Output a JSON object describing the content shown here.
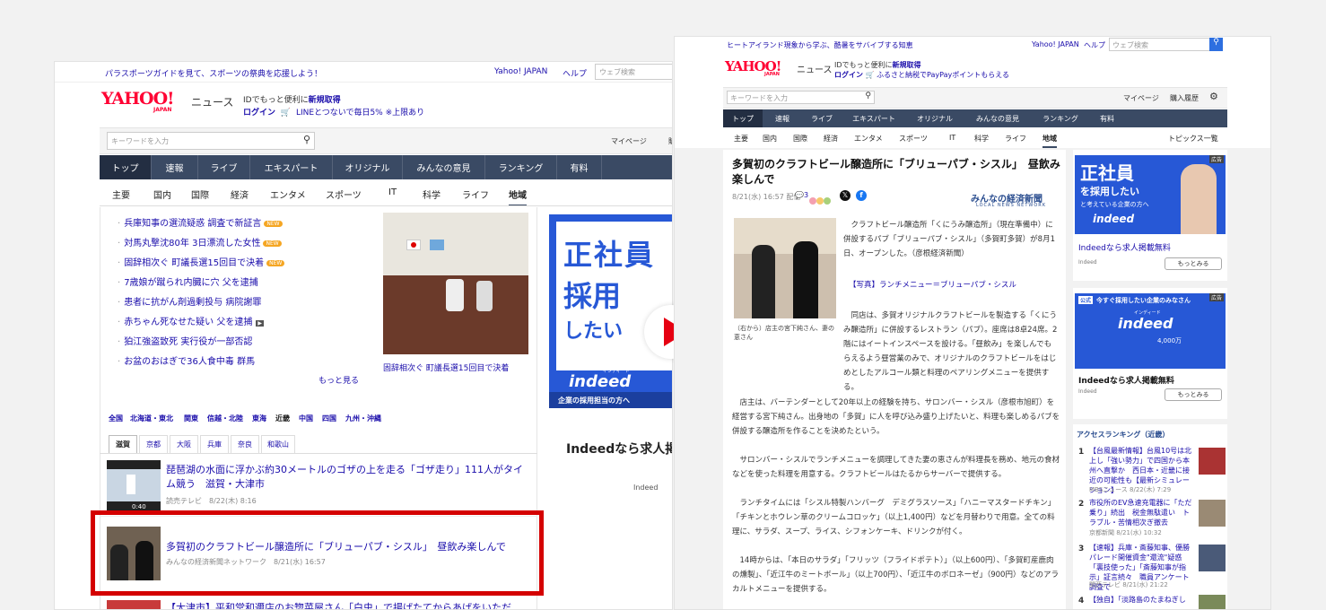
{
  "left": {
    "promo": "パラスポーツガイドを見て、スポーツの祭典を応援しよう！",
    "top_links": [
      "Yahoo! JAPAN",
      "ヘルプ"
    ],
    "search_placeholder": "ウェブ検索",
    "logo": "YAHOO!",
    "logo_sub": "JAPAN",
    "logo_section": "ニュース",
    "id_text": "IDでもっと便利に",
    "id_link": "新規取得",
    "login": "ログイン",
    "line_promo": "LINEとつないで毎日5% ※上限あり",
    "keyword_placeholder": "キーワードを入力",
    "mypage": "マイページ",
    "mypage_cut": "購",
    "nav": [
      "トップ",
      "速報",
      "ライブ",
      "エキスパート",
      "オリジナル",
      "みんなの意見",
      "ランキング",
      "有料"
    ],
    "subnav": [
      "主要",
      "国内",
      "国際",
      "経済",
      "エンタメ",
      "スポーツ",
      "IT",
      "科学",
      "ライフ",
      "地域"
    ],
    "topics": [
      {
        "text": "兵庫知事の選流疑惑 調査で新証言",
        "new": true
      },
      {
        "text": "対馬丸撃沈80年 3日漂流した女性",
        "new": true
      },
      {
        "text": "固辞相次ぐ 町議長選15回目で決着",
        "new": true
      },
      {
        "text": "7歳娘が蹴られ内臓に穴 父を逮捕",
        "new": false
      },
      {
        "text": "患者に抗がん剤過剰投与 病院謝罪",
        "new": false
      },
      {
        "text": "赤ちゃん死なせた疑い 父を逮捕",
        "new": false,
        "video": true
      },
      {
        "text": "狛江強盗致死 実行役が一部否認",
        "new": false
      },
      {
        "text": "お盆のおはぎで36人食中毒 群馬",
        "new": false
      }
    ],
    "new_label": "NEW",
    "more": "もっと見る",
    "photo_caption": "固辞相次ぐ 町議長選15回目で決着",
    "ad": {
      "line1": "正社員",
      "line2": "採用",
      "line3": "したい",
      "brand": "indeed",
      "brand_kana": "インディード",
      "cta": "企業の採用担当の方へ"
    },
    "ad_text": "Indeedなら求人掲",
    "ad_source": "Indeed",
    "regions": [
      "全国",
      "北海道・東北",
      "関東",
      "信越・北陸",
      "東海",
      "近畿",
      "中国",
      "四国",
      "九州・沖縄"
    ],
    "prefs": [
      "滋賀",
      "京都",
      "大阪",
      "兵庫",
      "奈良",
      "和歌山"
    ],
    "articles": [
      {
        "title": "琵琶湖の水面に浮かぶ約30メートルのゴザの上を走る「ゴザ走り」111人がタイム競う　滋賀・大津市",
        "meta": "読売テレビ　8/22(木) 8:16",
        "video_time": "0:40"
      },
      {
        "title": "多賀初のクラフトビール醸造所に「ブリューパブ・シスル」　昼飲み楽しんで",
        "meta": "みんなの経済新聞ネットワーク　8/21(水) 16:57"
      },
      {
        "title": "【大津市】平和堂和邇店のお惣菜屋さん「白虫」で揚げたてからあげをいただ",
        "meta": ""
      }
    ],
    "highlight_color": "#d40000"
  },
  "right": {
    "promo": "ヒートアイランド現象から学ぶ、酷暑をサバイブする知恵",
    "top_links": [
      "Yahoo! JAPAN",
      "ヘルプ"
    ],
    "search_placeholder": "ウェブ検索",
    "logo": "YAHOO!",
    "logo_sub": "JAPAN",
    "logo_section": "ニュース",
    "id_text": "IDでもっと便利に",
    "id_link": "新規取得",
    "login": "ログイン",
    "furusato": "ふるさと納税でPayPayポイントもらえる",
    "keyword_placeholder": "キーワードを入力",
    "header_links": [
      "マイページ",
      "購入履歴"
    ],
    "nav": [
      "トップ",
      "速報",
      "ライブ",
      "エキスパート",
      "オリジナル",
      "みんなの意見",
      "ランキング",
      "有料"
    ],
    "subnav": [
      "主要",
      "国内",
      "国際",
      "経済",
      "エンタメ",
      "スポーツ",
      "IT",
      "科学",
      "ライフ",
      "地域"
    ],
    "topics_list": "トピックス一覧",
    "article_title": "多賀初のクラフトビール醸造所に「ブリューパブ・シスル」　昼飲み楽しんで",
    "article_date": "8/21(水) 16:57 配信",
    "comment_count": "3",
    "source_logo": "みんなの経済新聞",
    "source_logo_sub": "LOCAL NEWS NETWORK",
    "photo_caption": "（右から）店主の宮下純さん、妻の恵さん",
    "lead": "クラフトビール醸造所「くにうみ醸造所」（現在準備中）に併設するパブ「ブリューパブ・シスル」（多賀町多賀）が8月1日、オープンした。（彦根経済新聞）",
    "photo_link": "【写真】ランチメニュー＝ブリューパブ・シスル",
    "p1": "同店は、多賀オリジナルクラフトビールを製造する「くにうみ醸造所」に併設するレストラン（パブ）。座席は8卓24席。2階にはイートインスペースを設ける。「昼飲み」を楽しんでもらえるよう昼営業のみで、オリジナルのクラフトビールをはじめとしたアルコール類と料理のペアリングメニューを提供する。",
    "p2": "店主は、バーテンダーとして20年以上の経験を持ち、サロンバー・シスル（彦根市旭町）を経営する宮下純さん。出身地の「多賀」に人を呼び込み盛り上げたいと、料理も楽しめるパブを併設する醸造所を作ることを決めたという。",
    "p3": "サロンバー・シスルでランチメニューを調理してきた妻の恵さんが料理長を務め、地元の食材などを使った料理を用意する。クラフトビールはたるからサーバーで提供する。",
    "p4": "ランチタイムには「シスル特製ハンバーグ　デミグラスソース」「ハニーマスタードチキン」「チキンとホウレン草のクリームコロッケ」（以上1,400円）などを月替わりで用意。全ての料理に、サラダ、スープ、ライス、シフォンケーキ、ドリンクが付く。",
    "p5": "14時からは、「本日のサラダ」「フリッツ（フライドポテト）」（以上600円）、「多賀町産鹿肉の燻製」、「近江牛のミートボール」（以上700円）、「近江牛のボロネーゼ」（900円）などのアラカルトメニューを提供する。",
    "ad1": {
      "tag": "広告",
      "line1": "正社員",
      "line2": "を採用したい",
      "line3": "と考えている企業の方へ",
      "brand": "indeed",
      "title": "Indeedなら求人掲載無料",
      "source": "Indeed",
      "button": "もっとみる"
    },
    "ad2": {
      "tag": "広告",
      "official": "公式",
      "headline": "今すぐ採用したい企業のみなさん",
      "brand": "indeed",
      "brand_kana": "インディード",
      "stat": "4,000万",
      "title": "Indeedなら求人掲載無料",
      "source": "Indeed",
      "button": "もっとみる"
    },
    "ranking_title": "アクセスランキング（近畿）",
    "ranking": [
      {
        "num": "1",
        "text": "【台風最新情報】台風10号は北上し「強い勢力」で四国から本州へ直撃か　西日本・近畿に接近の可能性も【最新シミュレーション】",
        "src": "MBSニュース 8/22(木) 7:29"
      },
      {
        "num": "2",
        "text": "市役所のEV急速充電器に「ただ乗り」続出　税金無駄遣い　トラブル・苦情相次ぎ撤去",
        "src": "京都新聞 8/21(水) 10:32"
      },
      {
        "num": "3",
        "text": "【速報】兵庫・斎藤知事、優勝パレード開催資金\"還流\"疑惑「裏技使った」「斎藤知事が指示」証言続々　職員アンケート調査で",
        "src": "関西テレビ 8/21(水) 21:22"
      },
      {
        "num": "4",
        "text": "【独自】「淡路島のたまねぎし",
        "src": ""
      }
    ]
  },
  "arrow_color": "#e60012"
}
